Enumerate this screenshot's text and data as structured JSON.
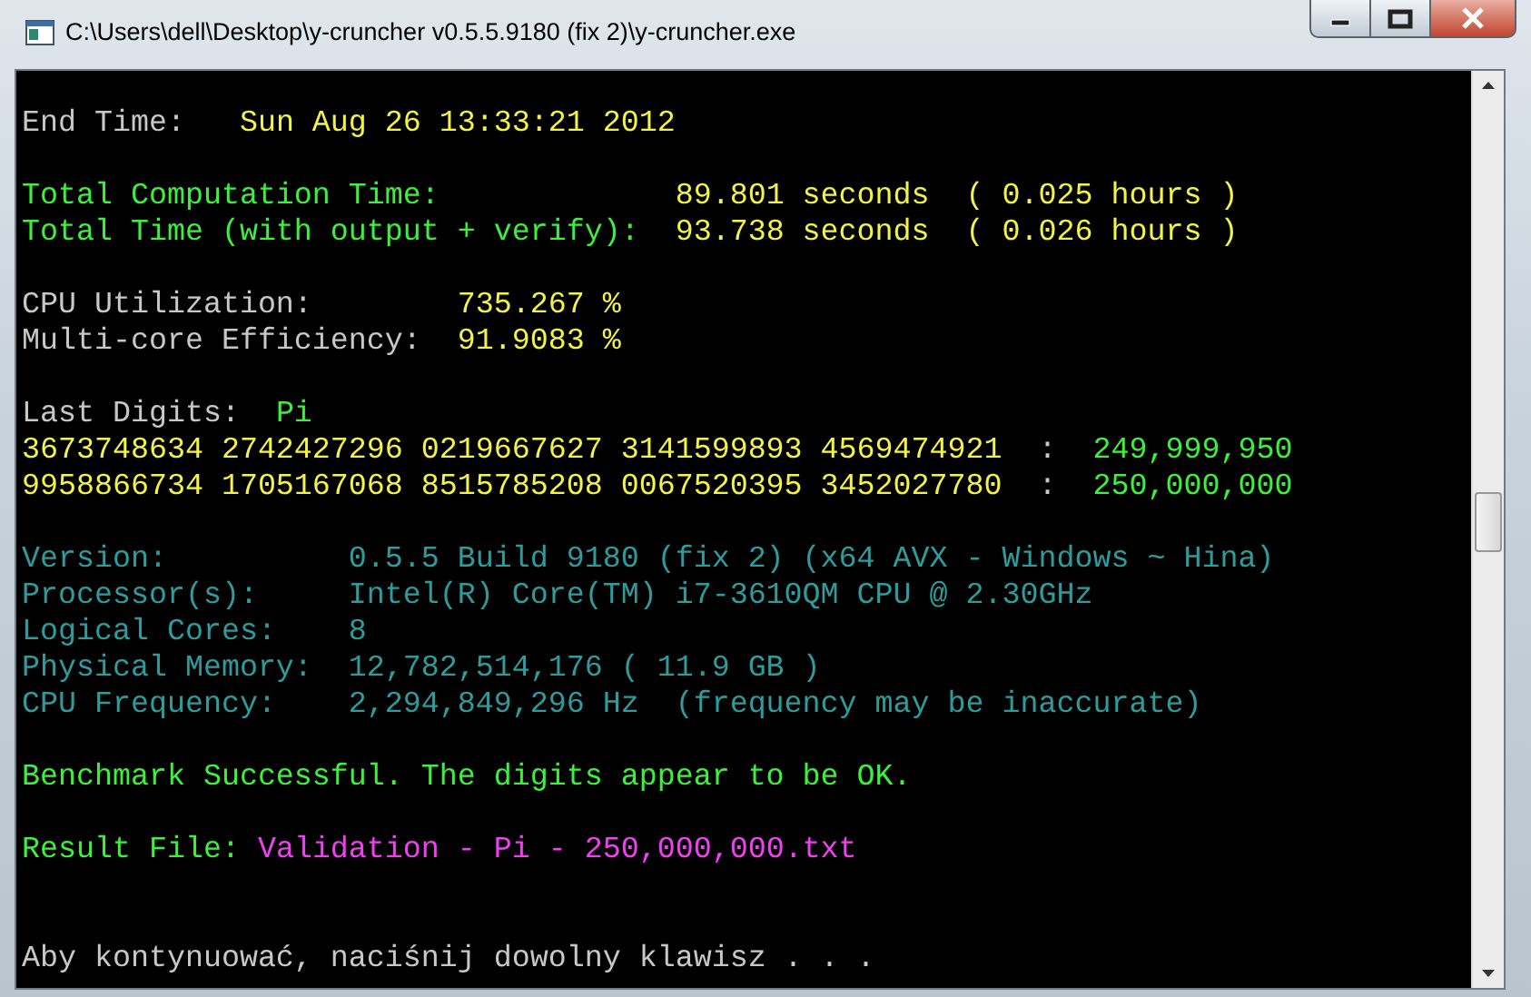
{
  "window": {
    "title": "C:\\Users\\dell\\Desktop\\y-cruncher v0.5.5.9180 (fix 2)\\y-cruncher.exe"
  },
  "console": {
    "lines": [
      {
        "kind": "text",
        "segments": [
          {
            "kind": "plain",
            "text": "End Time:   "
          },
          {
            "kind": "value",
            "text": "Sun Aug 26 13:33:21 2012"
          }
        ]
      },
      {
        "kind": "blank"
      },
      {
        "kind": "text",
        "segments": [
          {
            "kind": "highlight",
            "text": "Total Computation Time:             "
          },
          {
            "kind": "value",
            "text": "89.801 seconds  ( 0.025 hours )"
          }
        ]
      },
      {
        "kind": "text",
        "segments": [
          {
            "kind": "highlight",
            "text": "Total Time (with output + verify):  "
          },
          {
            "kind": "value",
            "text": "93.738 seconds  ( 0.026 hours )"
          }
        ]
      },
      {
        "kind": "blank"
      },
      {
        "kind": "text",
        "segments": [
          {
            "kind": "plain",
            "text": "CPU Utilization:        "
          },
          {
            "kind": "value",
            "text": "735.267 %"
          }
        ]
      },
      {
        "kind": "text",
        "segments": [
          {
            "kind": "plain",
            "text": "Multi-core Efficiency:  "
          },
          {
            "kind": "value",
            "text": "91.9083 %"
          }
        ]
      },
      {
        "kind": "blank"
      },
      {
        "kind": "text",
        "segments": [
          {
            "kind": "plain",
            "text": "Last Digits:  "
          },
          {
            "kind": "highlight",
            "text": "Pi"
          }
        ]
      },
      {
        "kind": "text",
        "segments": [
          {
            "kind": "value",
            "text": "3673748634 2742427296 0219667627 3141599893 4569474921"
          },
          {
            "kind": "plain",
            "text": "  :  "
          },
          {
            "kind": "highlight",
            "text": "249,999,950"
          }
        ]
      },
      {
        "kind": "text",
        "segments": [
          {
            "kind": "value",
            "text": "9958866734 1705167068 8515785208 0067520395 3452027780"
          },
          {
            "kind": "plain",
            "text": "  :  "
          },
          {
            "kind": "highlight",
            "text": "250,000,000"
          }
        ]
      },
      {
        "kind": "blank"
      },
      {
        "kind": "text",
        "segments": [
          {
            "kind": "info",
            "text": "Version:          0.5.5 Build 9180 (fix 2) (x64 AVX - Windows ~ Hina)"
          }
        ]
      },
      {
        "kind": "text",
        "segments": [
          {
            "kind": "info",
            "text": "Processor(s):     Intel(R) Core(TM) i7-3610QM CPU @ 2.30GHz"
          }
        ]
      },
      {
        "kind": "text",
        "segments": [
          {
            "kind": "info",
            "text": "Logical Cores:    8"
          }
        ]
      },
      {
        "kind": "text",
        "segments": [
          {
            "kind": "info",
            "text": "Physical Memory:  12,782,514,176 ( 11.9 GB )"
          }
        ]
      },
      {
        "kind": "text",
        "segments": [
          {
            "kind": "info",
            "text": "CPU Frequency:    2,294,849,296 Hz  (frequency may be inaccurate)"
          }
        ]
      },
      {
        "kind": "blank"
      },
      {
        "kind": "text",
        "segments": [
          {
            "kind": "highlight",
            "text": "Benchmark Successful. The digits appear to be OK."
          }
        ]
      },
      {
        "kind": "blank"
      },
      {
        "kind": "text",
        "segments": [
          {
            "kind": "highlight",
            "text": "Result File: "
          },
          {
            "kind": "file",
            "text": "Validation - Pi - 250,000,000.txt"
          }
        ]
      },
      {
        "kind": "blank"
      },
      {
        "kind": "blank"
      },
      {
        "kind": "text",
        "segments": [
          {
            "kind": "plain",
            "text": "Aby kontynuować, naciśnij dowolny klawisz . . ."
          }
        ]
      }
    ]
  }
}
